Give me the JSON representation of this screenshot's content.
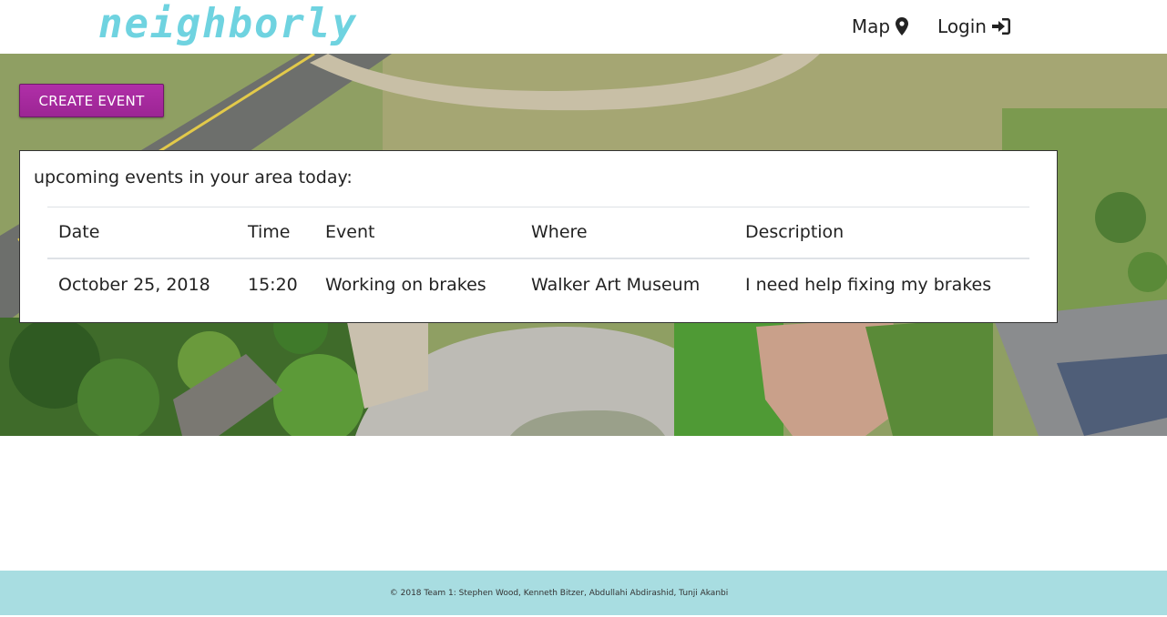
{
  "header": {
    "brand": "neighborly",
    "nav": [
      {
        "label": "Map",
        "icon": "map-marker-icon"
      },
      {
        "label": "Login",
        "icon": "sign-in-icon"
      }
    ]
  },
  "hero": {
    "create_button_label": "CREATE EVENT"
  },
  "events": {
    "heading": "upcoming events in your area today:",
    "columns": [
      "Date",
      "Time",
      "Event",
      "Where",
      "Description"
    ],
    "rows": [
      [
        "October 25, 2018",
        "15:20",
        "Working on brakes",
        "Walker Art Museum",
        "I need help fixing my brakes"
      ]
    ]
  },
  "footer": {
    "text": "© 2018 Team 1: Stephen Wood, Kenneth Bitzer, Abdullahi Abdirashid, Tunji Akanbi"
  },
  "colors": {
    "brand": "#6fd3e0",
    "button": "#a42b9c",
    "footer_bg": "#a8dde1"
  }
}
